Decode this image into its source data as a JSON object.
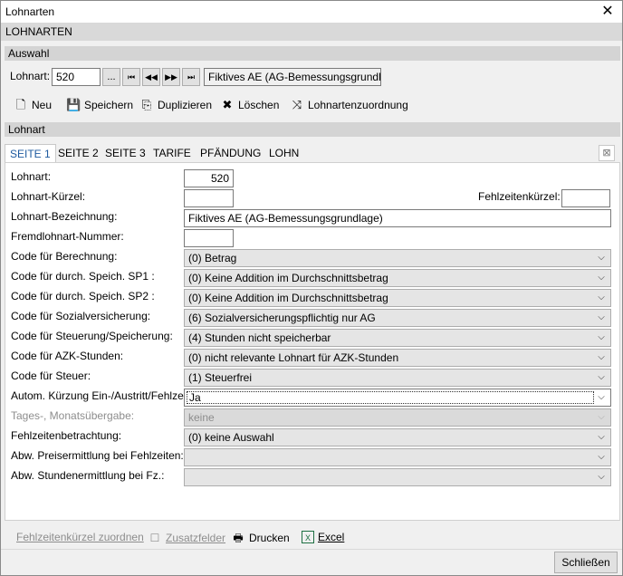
{
  "window": {
    "title": "Lohnarten",
    "header": "LOHNARTEN"
  },
  "auswahl": {
    "section_title": "Auswahl",
    "lohnart_label": "Lohnart:",
    "lohnart_value": "520",
    "browse_label": "...",
    "nav_first": "⏮",
    "nav_prev": "◀◀",
    "nav_next": "▶▶",
    "nav_last": "⏭",
    "selected_name": "Fiktives AE (AG-Bemessungsgrundlage)"
  },
  "toolbar": {
    "new_label": "Neu",
    "save_label": "Speichern",
    "duplicate_label": "Duplizieren",
    "delete_label": "Löschen",
    "assign_label": "Lohnartenzuordnung"
  },
  "lohnart_section": {
    "title": "Lohnart"
  },
  "tabs": [
    {
      "label": "SEITE 1"
    },
    {
      "label": "SEITE 2"
    },
    {
      "label": "SEITE 3"
    },
    {
      "label": "TARIFE"
    },
    {
      "label": "PFÄNDUNG"
    },
    {
      "label": "LOHN"
    }
  ],
  "form": {
    "lohnart_label": "Lohnart:",
    "lohnart_value": "520",
    "kuerzel_label": "Lohnart-Kürzel:",
    "kuerzel_value": "",
    "fehlzeitenkuerzel_label": "Fehlzeitenkürzel:",
    "fehlzeitenkuerzel_value": "",
    "bezeichnung_label": "Lohnart-Bezeichnung:",
    "bezeichnung_value": "Fiktives AE (AG-Bemessungsgrundlage)",
    "fremd_label": "Fremdlohnart-Nummer:",
    "fremd_value": "",
    "combos": [
      {
        "label": "Code für Berechnung:",
        "value": "(0) Betrag"
      },
      {
        "label": "Code für durch. Speich. SP1 :",
        "value": "(0) Keine Addition im Durchschnittsbetrag"
      },
      {
        "label": "Code für durch. Speich. SP2 :",
        "value": "(0) Keine Addition im Durchschnittsbetrag"
      },
      {
        "label": "Code für Sozialversicherung:",
        "value": "(6) Sozialversicherungspflichtig nur AG"
      },
      {
        "label": "Code für Steuerung/Speicherung:",
        "value": "(4) Stunden nicht speicherbar"
      },
      {
        "label": "Code für AZK-Stunden:",
        "value": "(0) nicht relevante Lohnart für AZK-Stunden"
      },
      {
        "label": "Code für Steuer:",
        "value": "(1) Steuerfrei"
      },
      {
        "label": "Autom. Kürzung Ein-/Austritt/Fehlzeit:",
        "value": "Ja"
      },
      {
        "label": "Tages-, Monatsübergabe:",
        "value": "keine"
      },
      {
        "label": "Fehlzeitenbetrachtung:",
        "value": "(0) keine Auswahl"
      },
      {
        "label": "Abw. Preisermittlung bei Fehlzeiten:",
        "value": ""
      },
      {
        "label": "Abw. Stundenermittlung bei Fz.:",
        "value": ""
      }
    ]
  },
  "bottom": {
    "fehlzeiten_label": "Fehlzeitenkürzel zuordnen",
    "zusatz_label": "Zusatzfelder",
    "print_label": "Drucken",
    "excel_label": "Excel",
    "close_label": "Schließen"
  }
}
